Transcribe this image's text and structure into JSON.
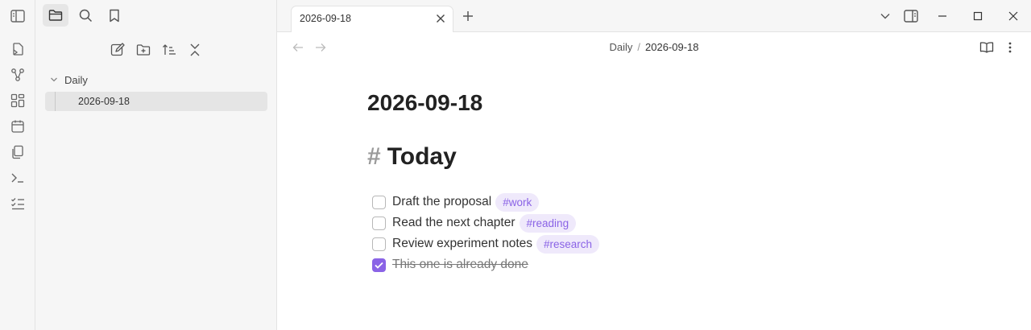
{
  "tab": {
    "title": "2026-09-18"
  },
  "sidebar": {
    "folder": "Daily",
    "file": "2026-09-18"
  },
  "breadcrumb": {
    "folder": "Daily",
    "separator": "/",
    "current": "2026-09-18"
  },
  "note": {
    "title": "2026-09-18",
    "heading_marker": "#",
    "heading": "Today",
    "tasks": [
      {
        "text": "Draft the proposal",
        "tag": "#work",
        "done": false
      },
      {
        "text": "Read the next chapter",
        "tag": "#reading",
        "done": false
      },
      {
        "text": "Review experiment notes",
        "tag": "#research",
        "done": false
      },
      {
        "text": "This one is already done",
        "tag": "",
        "done": true
      }
    ]
  },
  "colors": {
    "accent": "#8a63e6",
    "tag_bg": "#efe9fb",
    "sidebar_bg": "#f6f6f6"
  },
  "icons": {
    "ribbon": [
      "sidebar-toggle-icon",
      "open-quick-switcher-icon",
      "graph-view-icon",
      "canvas-icon",
      "daily-note-calendar-icon",
      "templates-icon",
      "command-palette-icon",
      "tasks-icon"
    ],
    "sidebar_tabs": [
      "folder-icon",
      "search-icon",
      "bookmark-icon"
    ],
    "sidebar_actions": [
      "new-note-icon",
      "new-folder-icon",
      "sort-icon",
      "collapse-all-icon"
    ]
  }
}
